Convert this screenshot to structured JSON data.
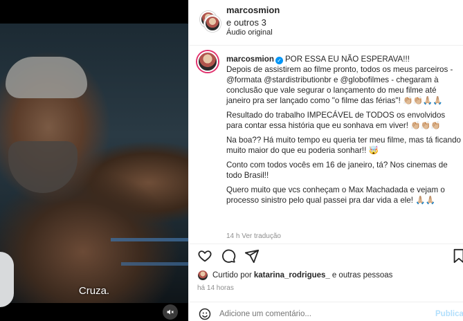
{
  "video": {
    "subtitle": "Cruza.",
    "mute_icon": "speaker-muted-icon"
  },
  "header": {
    "username": "marcosmion",
    "others": "e outros 3",
    "audio": "Áudio original"
  },
  "caption": {
    "username": "marcosmion",
    "line1": "POR ESSA EU NÃO ESPERAVA!!!",
    "para1": "Depois de assistirem ao filme pronto, todos os meus parceiros - @formata @stardistributionbr e @globofilmes - chegaram à conclusão que vale segurar o lançamento do meu filme até janeiro pra ser lançado como \"o filme das férias\"! 👏🏼👏🏼🙏🏼🙏🏼",
    "para2": "Resultado do trabalho IMPECÁVEL de TODOS os envolvidos para contar essa história que eu sonhava em viver! 👏🏼👏🏼👏🏼",
    "para3": "Na boa?? Há muito tempo eu queria ter meu filme, mas tá ficando muito maior do que eu poderia sonhar!! 🤯",
    "para4": "Conto com todos vocês em 16 de janeiro, tá? Nos cinemas de todo Brasil!!",
    "para5": "Quero muito que vcs conheçam o Max Machadada e vejam o processo sinistro pelo qual passei pra dar vida a ele! 🙏🏼🙏🏼",
    "meta": "14 h    Ver tradução"
  },
  "likes": {
    "prefix": "Curtido por",
    "user": "katarina_rodrigues_",
    "suffix": "e outras pessoas"
  },
  "time": "há 14 horas",
  "comment": {
    "placeholder": "Adicione um comentário...",
    "publish": "Publicar"
  },
  "colors": {
    "verified": "#0095f6",
    "publish": "#b2dffc",
    "muted_text": "#8e8e8e"
  }
}
